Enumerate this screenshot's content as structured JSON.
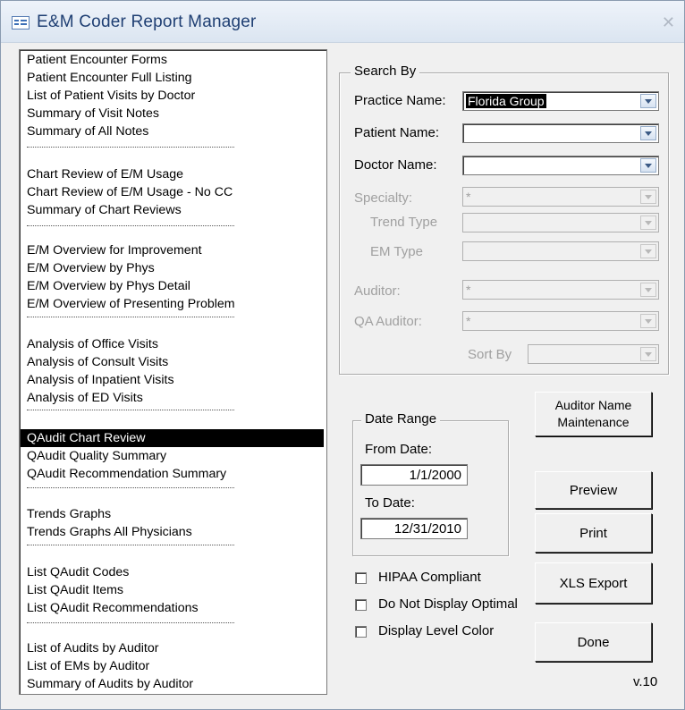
{
  "window": {
    "title": "E&M Coder Report Manager",
    "close_glyph": "✕",
    "icon": "report-window-icon"
  },
  "report_list": {
    "selected_index": 17,
    "items": [
      "Patient Encounter Forms",
      "Patient Encounter Full Listing",
      "List of Patient Visits by Doctor",
      "Summary of Visit Notes",
      "Summary of All Notes",
      "Chart Review of E/M Usage",
      "Chart Review of E/M Usage - No CC",
      "Summary of Chart Reviews",
      "E/M Overview for Improvement",
      "E/M Overview by Phys",
      "E/M Overview by Phys Detail",
      "E/M Overview of Presenting Problem",
      "Analysis of Office Visits",
      "Analysis of Consult Visits",
      "Analysis of Inpatient Visits",
      "Analysis of ED Visits",
      "QAudit Chart Review",
      "QAudit Quality Summary",
      "QAudit Recommendation Summary",
      "Trends Graphs",
      "Trends Graphs All Physicians",
      "List QAudit Codes",
      "List QAudit Items",
      "List QAudit Recommendations",
      "List of Audits by Auditor",
      "List of EMs by Auditor",
      "Summary of Audits by Auditor"
    ]
  },
  "search": {
    "legend": "Search By",
    "practice_label": "Practice Name:",
    "practice_value": "Florida Group",
    "patient_label": "Patient Name:",
    "patient_value": "",
    "doctor_label": "Doctor Name:",
    "doctor_value": "",
    "specialty_label": "Specialty:",
    "specialty_value": "*",
    "trend_type_label": "Trend Type",
    "trend_type_value": "",
    "em_type_label": "EM Type",
    "em_type_value": "",
    "auditor_label": "Auditor:",
    "auditor_value": "*",
    "qa_auditor_label": "QA Auditor:",
    "qa_auditor_value": "*",
    "sort_by_label": "Sort By",
    "sort_by_value": ""
  },
  "date_range": {
    "legend": "Date Range",
    "from_label": "From Date:",
    "from_value": "1/1/2000",
    "to_label": "To Date:",
    "to_value": "12/31/2010"
  },
  "options": {
    "hipaa_label": "HIPAA Compliant",
    "hipaa_checked": false,
    "no_optimal_label": "Do Not Display Optimal",
    "no_optimal_checked": false,
    "level_color_label": "Display Level  Color",
    "level_color_checked": false
  },
  "buttons": {
    "auditor_maint_line1": "Auditor Name",
    "auditor_maint_line2": "Maintenance",
    "preview": "Preview",
    "print": "Print",
    "xls_export": "XLS Export",
    "done": "Done"
  },
  "version": "v.10"
}
